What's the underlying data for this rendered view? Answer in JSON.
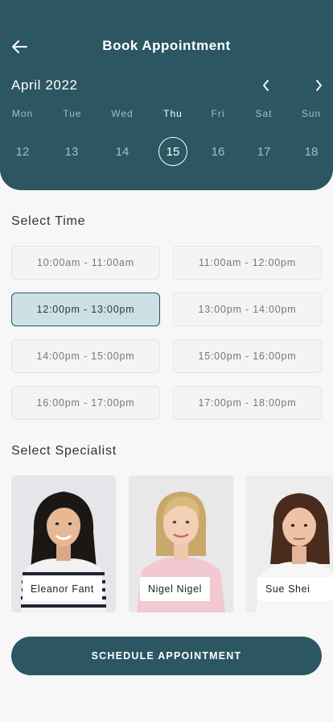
{
  "header": {
    "title": "Book Appointment",
    "back_icon": "arrow-left-icon",
    "background": "#2b5662"
  },
  "calendar": {
    "month": "April 2022",
    "prev_icon": "chevron-left-icon",
    "next_icon": "chevron-right-icon",
    "days": [
      {
        "name": "Mon",
        "date": "12",
        "selected": false
      },
      {
        "name": "Tue",
        "date": "13",
        "selected": false
      },
      {
        "name": "Wed",
        "date": "14",
        "selected": false
      },
      {
        "name": "Thu",
        "date": "15",
        "selected": true
      },
      {
        "name": "Fri",
        "date": "16",
        "selected": false
      },
      {
        "name": "Sat",
        "date": "17",
        "selected": false
      },
      {
        "name": "Sun",
        "date": "18",
        "selected": false
      }
    ]
  },
  "time_section": {
    "title": "Select Time",
    "slots": [
      {
        "label": "10:00am - 11:00am",
        "selected": false
      },
      {
        "label": "11:00am - 12:00pm",
        "selected": false
      },
      {
        "label": "12:00pm - 13:00pm",
        "selected": true
      },
      {
        "label": "13:00pm - 14:00pm",
        "selected": false
      },
      {
        "label": "14:00pm - 15:00pm",
        "selected": false
      },
      {
        "label": "15:00pm - 16:00pm",
        "selected": false
      },
      {
        "label": "16:00pm - 17:00pm",
        "selected": false
      },
      {
        "label": "17:00pm - 18:00pm",
        "selected": false
      }
    ]
  },
  "specialist_section": {
    "title": "Select Specialist",
    "specialists": [
      {
        "name": "Eleanor Fant"
      },
      {
        "name": "Nigel Nigel"
      },
      {
        "name": "Sue Shei"
      }
    ]
  },
  "cta": {
    "label": "SCHEDULE APPOINTMENT"
  },
  "colors": {
    "primary": "#2b5662",
    "selected_slot_bg": "#cde0e3",
    "day_muted": "#9fc0c6"
  }
}
